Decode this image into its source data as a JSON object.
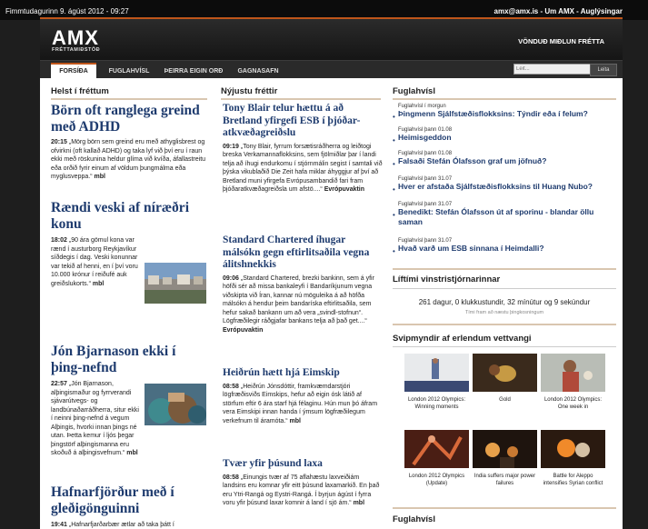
{
  "topbar": {
    "date": "Fimmtudagurinn 9. ágúst 2012 - 09:27",
    "email": "amx@amx.is",
    "sep1": " - ",
    "about": "Um AMX",
    "sep2": " - ",
    "ads": "Auglýsingar"
  },
  "header": {
    "logo": "AMX",
    "logo_sub": "FRÉTTAMIÐSTÖÐ",
    "tagline": "VÖNDUÐ MIÐLUN FRÉTTA"
  },
  "nav": {
    "tabs": [
      "FORSÍÐA",
      "FUGLAHVÍSL",
      "ÞEIRRA EIGIN ORÐ",
      "GAGNASAFN"
    ],
    "search_placeholder": "Leit...",
    "search_button": "Leita"
  },
  "col1": {
    "heading": "Helst í fréttum",
    "articles": [
      {
        "title": "Börn oft ranglega greind með ADHD",
        "time": "20:15",
        "text": "„Mörg börn sem greind eru með athyglisbrest og ofvirkni (oft kallað ADHD) og taka lyf við því eru í raun ekki með röskunina heldur glíma við kvíða, áfallastreitu eða orðið fyrir einum af völdum þungmálma eða myglusveppa.“",
        "source": "mbl"
      },
      {
        "title": "Rændi veski af níræðri konu",
        "time": "18:02",
        "text": "„90 ára gömul kona var rænd í austurborg Reykjavíkur síðdegis í dag. Veski konunnar var tekið af henni, en í því voru 10.000 krónur í reiðufé auk greiðslukorts.“",
        "source": "mbl"
      },
      {
        "title": "Jón Bjarnason ekki í þing-nefnd",
        "time": "22:57",
        "text": "„Jón Bjarnason, alþingismaður og fyrrverandi sjávarútvegs- og landbúnaðarráðherra, situr ekki í neinni þing-nefnd á vegum Alþingis, hvorki innan þings né utan. Þetta kemur í ljós þegar þingstörf alþingismanna eru skoðuð á alþingisvefnum.“",
        "source": "mbl"
      },
      {
        "title": "Hafnarfjörður með í gleðigönguinni",
        "time": "19:41",
        "text": "„Hafnarfjarðarbær ætlar að taka þátt í",
        "source": ""
      }
    ]
  },
  "col2": {
    "heading": "Nýjustu fréttir",
    "articles": [
      {
        "title": "Tony Blair telur hættu á að Bretland yfirgefi ESB í þjóðar-atkvæðagreiðslu",
        "time": "09:19",
        "text": "„Tony Blair, fyrrum forsætisráðherra og leiðtogi breska Verkamannaflokksins, sem fjölmiðlar þar í landi telja að íhugi endurkomu í stjórnmálin segist í samtali við þýska vikublaðið Die Zeit hafa miklar áhyggjur af því að Bretland muni yfirgefa Evrópusambandið fari fram þjóðaratkvæðagreiðsla um afstö....“",
        "source": "Evrópuvaktin"
      },
      {
        "title": "Standard Chartered íhugar málsókn gegn eftirlitsaðila vegna álitshnekkis",
        "time": "09:06",
        "text": "„Standard Chartered, brezki bankinn, sem á yfir höfði sér að missa bankaleyfi í Bandaríkjunum vegna viðskipta við Íran, kannar nú möguleika á að höfða málsókn á hendur þeim bandaríska eftirlitsaðila, sem hefur sakað bankann um að vera „svindl-stofnun“. Lögfræðilegir ráðgjafar bankans telja að það get....“",
        "source": "Evrópuvaktin"
      },
      {
        "title": "Heiðrún hætt hjá Eimskip",
        "time": "08:58",
        "text": "„Heiðrún Jónsdóttir, framkvæmdarstjóri lögfræðisviðs Eimskips, hefur að eigin ósk látið af störfum eftir 6 ára starf hjá félaginu. Hún mun þó áfram vera Eimskipi innan handa í ýmsum lögfræðilegum verkefnum til áramóta.“",
        "source": "mbl"
      },
      {
        "title": "Tvær yfir þúsund laxa",
        "time": "08:58",
        "text": "„Einungis tvær af 75 aflahæstu laxveiðiám landsins eru komnar yfir eitt þúsund laxamarkið. En það eru Ytri-Rangá og Eystri-Rangá. Í byrjun ágúst í fyrra voru yfir þúsund laxar komnir á land í sjö ám.“",
        "source": "mbl"
      }
    ]
  },
  "col3": {
    "heading": "Fuglahvísl",
    "items": [
      {
        "date": "Fuglahvísl í morgun",
        "title": "Þingmenn Sjálfstæðisflokksins: Týndir eða í felum?"
      },
      {
        "date": "Fuglahvísl þann 01.08",
        "title": "Heimisgeddon"
      },
      {
        "date": "Fuglahvísl þann 01.08",
        "title": "Falsaði Stefán Ólafsson graf um jöfnuð?"
      },
      {
        "date": "Fuglahvísl þann 31.07",
        "title": "Hver er afstaða Sjálfstæðisflokksins til Huang Nubo?"
      },
      {
        "date": "Fuglahvísl þann 31.07",
        "title": "Benedikt: Stefán Ólafsson út af sporinu - blandar öllu saman"
      },
      {
        "date": "Fuglahvísl þann 31.07",
        "title": "Hvað varð um ESB sinnana í Heimdalli?"
      }
    ],
    "lifetime_heading": "Líftími vinstristjórnarinnar",
    "counter": "261 dagur, 0 klukkustundir, 32 mínútur og 9 sekúndur",
    "counter_sub": "Tími fram að næstu þingkosningum",
    "photos_heading": "Svipmyndir af erlendum vettvangi",
    "photos": [
      {
        "caption": "London 2012 Olympics: Winning moments"
      },
      {
        "caption": "Gold"
      },
      {
        "caption": "London 2012 Olympics: One week in"
      },
      {
        "caption": "London 2012 Olympics (Update)"
      },
      {
        "caption": "India suffers major power failures"
      },
      {
        "caption": "Battle for Aleppo intensifies Syrian conflict"
      }
    ],
    "bottom_heading": "Fuglahvísl"
  },
  "colors": {
    "accent": "#c0561b",
    "link": "#1e3b6e"
  }
}
